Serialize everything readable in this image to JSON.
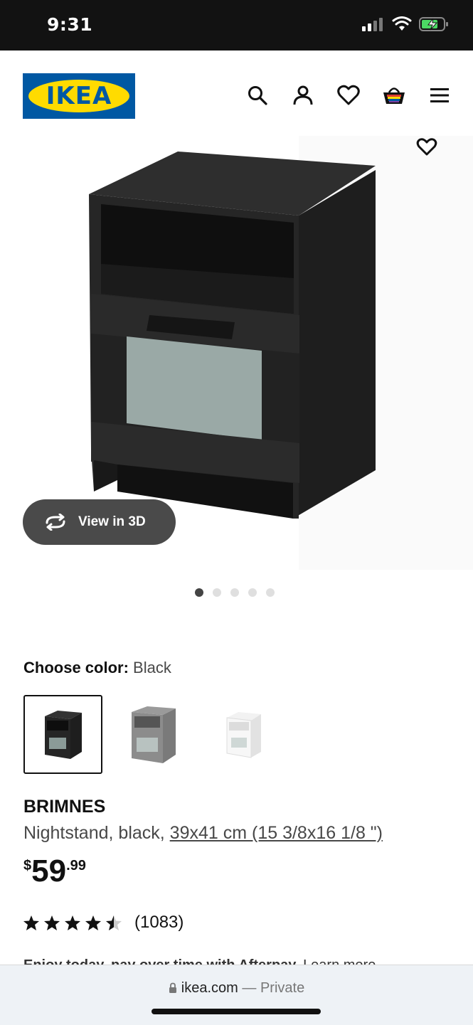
{
  "status_bar": {
    "time": "9:31"
  },
  "header": {
    "logo_text": "IKEA",
    "icons": [
      "search-icon",
      "account-icon",
      "heart-icon",
      "basket-icon",
      "menu-icon"
    ]
  },
  "gallery": {
    "view3d_label": "View in 3D",
    "dots_total": 5,
    "active_dot": 0
  },
  "color": {
    "label": "Choose color:",
    "value": "Black",
    "options": [
      "Black",
      "Gray",
      "White"
    ]
  },
  "product": {
    "name": "BRIMNES",
    "desc_prefix": "Nightstand, black, ",
    "dimensions": "39x41 cm (15 3/8x16 1/8 \")",
    "price_currency": "$",
    "price_int": "59",
    "price_dec": ".99",
    "rating": 4.5,
    "review_count": "(1083)"
  },
  "afterpay": {
    "text": "Enjoy today, pay over time with Afterpay.",
    "link": "Learn more"
  },
  "browser": {
    "domain": "ikea.com",
    "sep": " — ",
    "mode": "Private"
  },
  "colors": {
    "ikea_blue": "#0058a3",
    "ikea_yellow": "#ffdb00"
  }
}
